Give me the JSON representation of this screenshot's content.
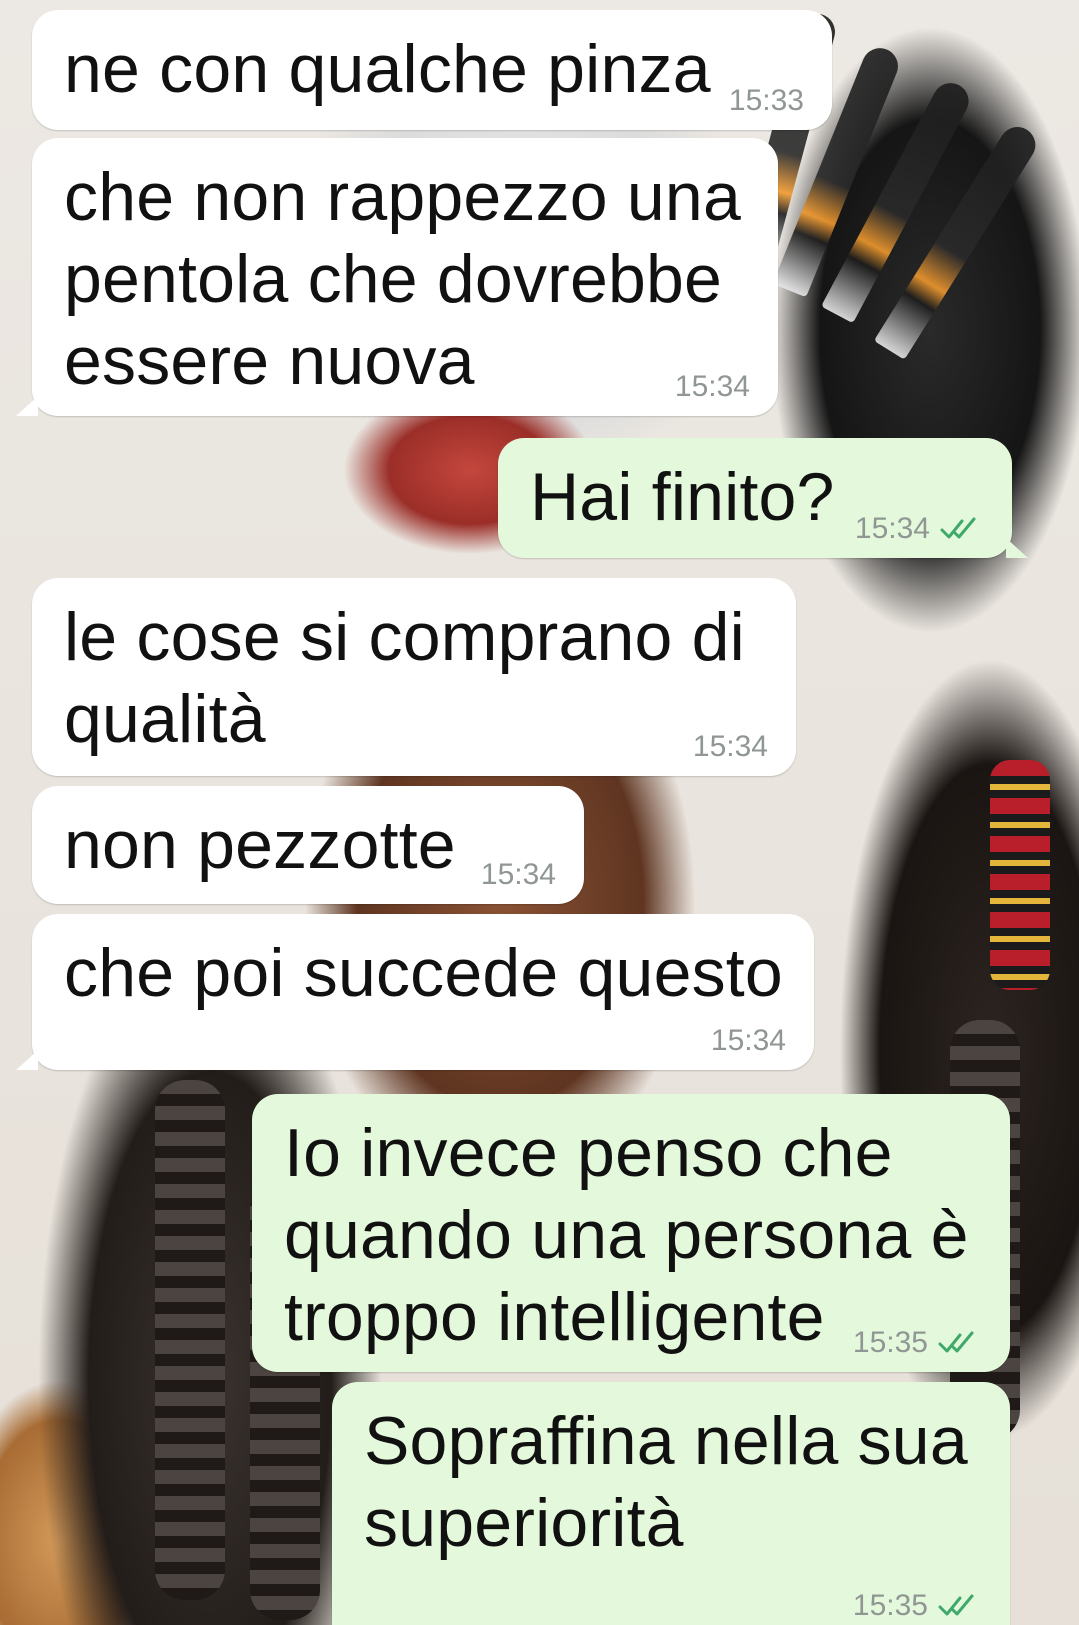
{
  "messages": [
    {
      "direction": "incoming",
      "text": "ne con qualche pinza",
      "time": "15:33"
    },
    {
      "direction": "incoming",
      "text": "che non rappezzo una\npentola che dovrebbe\nessere nuova",
      "time": "15:34"
    },
    {
      "direction": "outgoing",
      "text": "Hai finito?",
      "time": "15:34",
      "status": "read"
    },
    {
      "direction": "incoming",
      "text": "le cose si comprano di\nqualità",
      "time": "15:34"
    },
    {
      "direction": "incoming",
      "text": "non pezzotte",
      "time": "15:34"
    },
    {
      "direction": "incoming",
      "text": "che poi succede questo",
      "time": "15:34"
    },
    {
      "direction": "outgoing",
      "text": "Io invece penso che\nquando una persona è\ntroppo intelligente",
      "time": "15:35",
      "status": "read"
    },
    {
      "direction": "outgoing",
      "text": "Sopraffina nella sua\nsuperiorità",
      "time": "15:35",
      "status": "read"
    }
  ],
  "colors": {
    "incoming_bubble": "#ffffff",
    "outgoing_bubble": "#e4f9dc",
    "read_check": "#3fa96a",
    "timestamp": "#8f9694"
  },
  "icons": {
    "read_receipt": "double-check-icon"
  }
}
